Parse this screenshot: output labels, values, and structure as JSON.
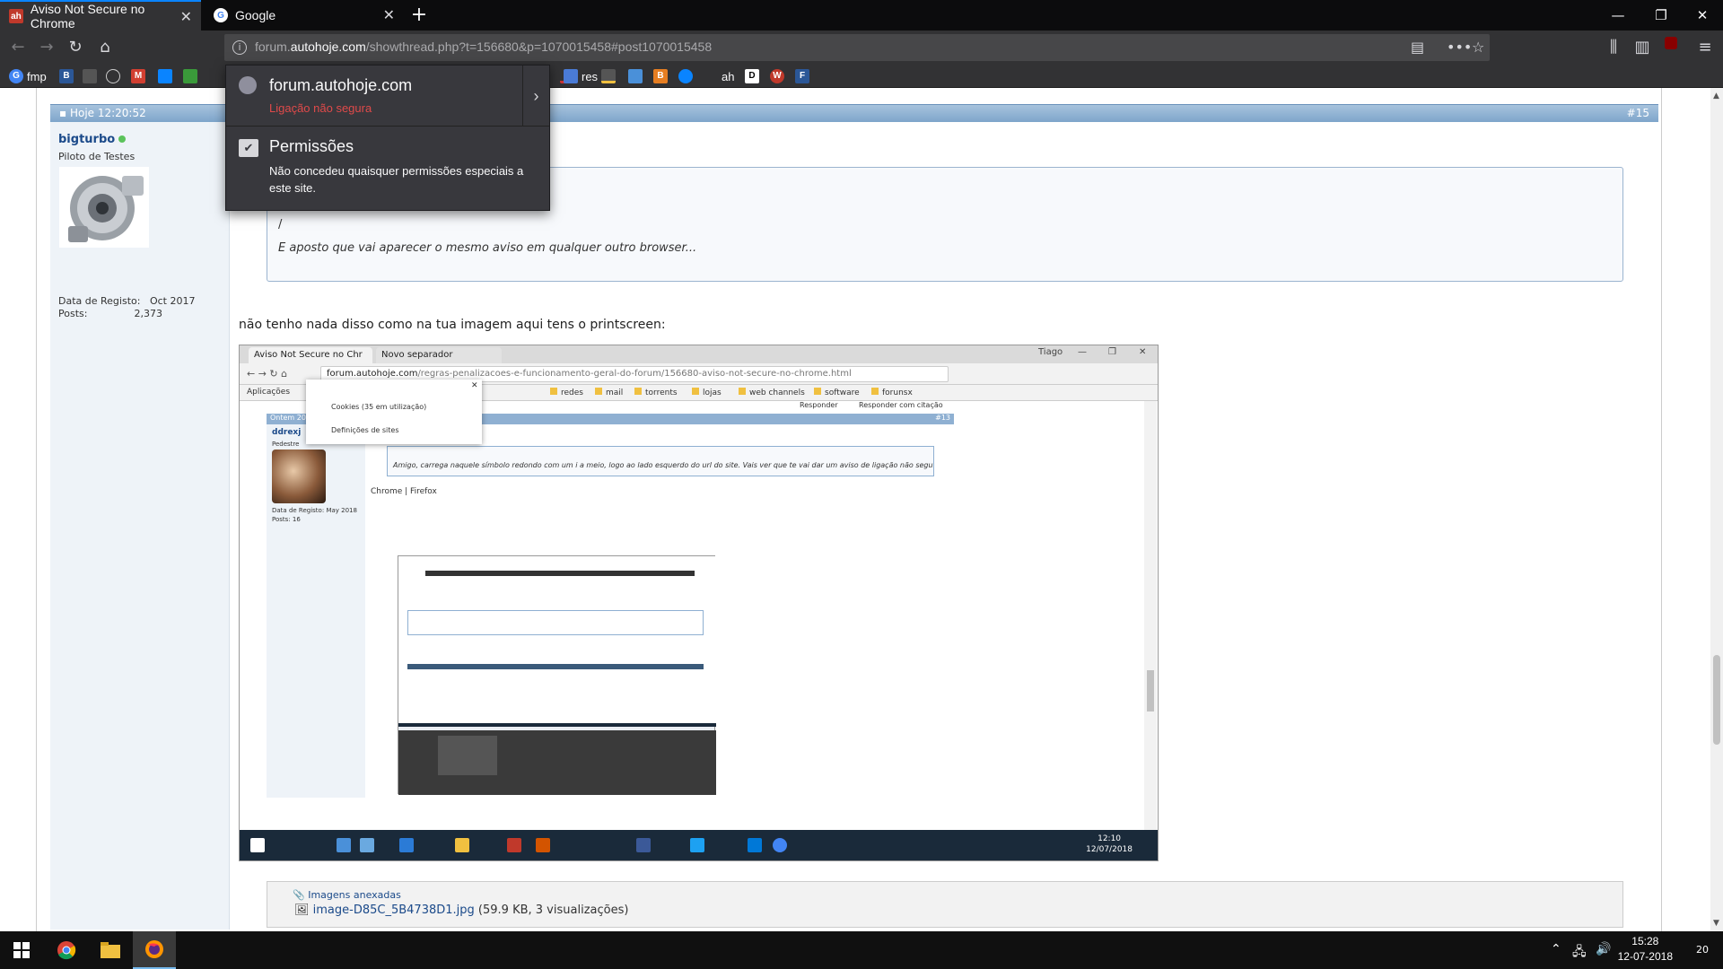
{
  "browser": {
    "tabs": [
      {
        "title": "Aviso Not Secure no Chrome",
        "favicon": "ah"
      },
      {
        "title": "Google",
        "favicon": "G"
      }
    ],
    "url_prefix": "forum.",
    "url_domain": "autohoje.com",
    "url_path": "/showthread.php?t=156680&p=1070015458#post1070015458",
    "bookmarks": [
      {
        "label": "fmp",
        "icon": "G",
        "color": "#4285f4"
      },
      {
        "label": "",
        "icon": "B",
        "color": "#2b5797"
      },
      {
        "label": "",
        "icon": "M",
        "color": "#d23f31"
      },
      {
        "label": "res",
        "icon": "",
        "color": "#4a7bd6"
      },
      {
        "label": "ah",
        "icon": "",
        "color": "#555"
      },
      {
        "label": "",
        "icon": "W",
        "color": "#c0392b"
      }
    ]
  },
  "identity_popup": {
    "host": "forum.autohoje.com",
    "warning": "Ligação não segura",
    "perm_title": "Permissões",
    "perm_desc": "Não concedeu quaisquer permissões especiais a este site."
  },
  "post": {
    "date": "Hoje 12:20:52",
    "number": "#15",
    "username": "bigturbo",
    "user_title": "Piloto de Testes",
    "registo_label": "Data de Registo:",
    "registo_value": "Oct 2017",
    "posts_label": "Posts:",
    "posts_value": "2,373",
    "quote_line1": "/",
    "quote_line2": "E aposto que vai aparecer o mesmo aviso em qualquer outro browser...",
    "body": "não tenho nada disso como na tua imagem aqui tens o printscreen:",
    "attachments_label": "Imagens anexadas",
    "attachment_file": "image-D85C_5B4738D1.jpg",
    "attachment_meta": "(59.9 KB, 3 visualizações)"
  },
  "screenshot": {
    "tab1": "Aviso Not Secure no Chr",
    "tab2": "Novo separador",
    "user_chip": "Tiago",
    "url_domain": "forum.autohoje.com",
    "url_path": "/regras-penalizacoes-e-funcionamento-geral-do-forum/156680-aviso-not-secure-no-chrome.html",
    "bookmarks": [
      "Aplicações",
      "redes",
      "mail",
      "torrents",
      "lojas",
      "web channels",
      "software",
      "forunsx"
    ],
    "popup_cookies": "Cookies (35 em utilização)",
    "popup_sites": "Definições de sites",
    "post_date": "Ontem 20",
    "post_num": "#13",
    "username": "ddrexj",
    "user_title": "Pedestre",
    "registo": "Data de Registo:",
    "registo_value": "May 2018",
    "posts": "Posts:",
    "posts_value": "16",
    "quote": "Amigo, carrega naquele símbolo redondo com um i a meio, logo ao lado esquerdo do url do site. Vais ver que te vai dar um aviso de ligação não segura...",
    "caption": "Chrome | Firefox",
    "reply": "Responder",
    "reply_quote": "Responder com citação",
    "clock_time": "12:10",
    "clock_date": "12/07/2018"
  },
  "taskbar": {
    "time": "15:28",
    "date": "12-07-2018",
    "notifications": "20"
  }
}
